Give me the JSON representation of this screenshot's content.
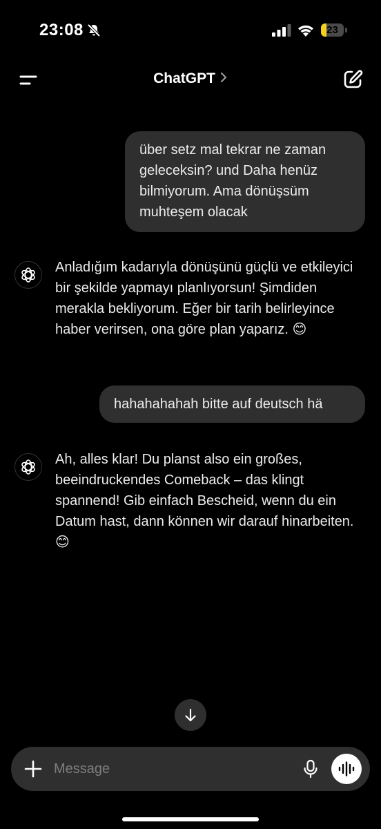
{
  "status_bar": {
    "time": "23:08",
    "battery_level": "23",
    "battery_fraction": 0.23,
    "icons": [
      "bell-slash-icon",
      "cellular-signal-icon",
      "wifi-icon",
      "battery-icon"
    ]
  },
  "header": {
    "title": "ChatGPT",
    "icons": [
      "menu-icon",
      "chevron-right-icon",
      "compose-icon"
    ]
  },
  "conversation": {
    "messages": [
      {
        "role": "user",
        "text": "über setz mal tekrar ne zaman geleceksin? und Daha henüz bilmiyorum. Ama dönüşsüm muhteşem olacak"
      },
      {
        "role": "assistant",
        "text": "Anladığım kadarıyla dönüşünü güçlü ve etkileyici bir şekilde yapmayı planlıyorsun! Şimdiden merakla bekliyorum. Eğer bir tarih belirleyince haber verirsen, ona göre plan yaparız. 😊"
      },
      {
        "role": "user",
        "text": "hahahahahah bitte auf deutsch hä"
      },
      {
        "role": "assistant",
        "text": "Ah, alles klar! Du planst also ein großes, beeindruckendes Comeback – das klingt spannend! Gib einfach Bescheid, wenn du ein Datum hast, dann können wir darauf hinarbeiten. 😊"
      }
    ]
  },
  "composer": {
    "placeholder": "Message",
    "value": "",
    "icons": [
      "plus-icon",
      "microphone-icon",
      "voice-waveform-icon"
    ]
  },
  "scroll_down": {
    "icon": "arrow-down-icon"
  },
  "colors": {
    "background": "#000000",
    "bubble": "#2f2f2f",
    "text": "#ececec",
    "placeholder": "#7d7d7d",
    "battery_accent": "#f4d21f"
  }
}
